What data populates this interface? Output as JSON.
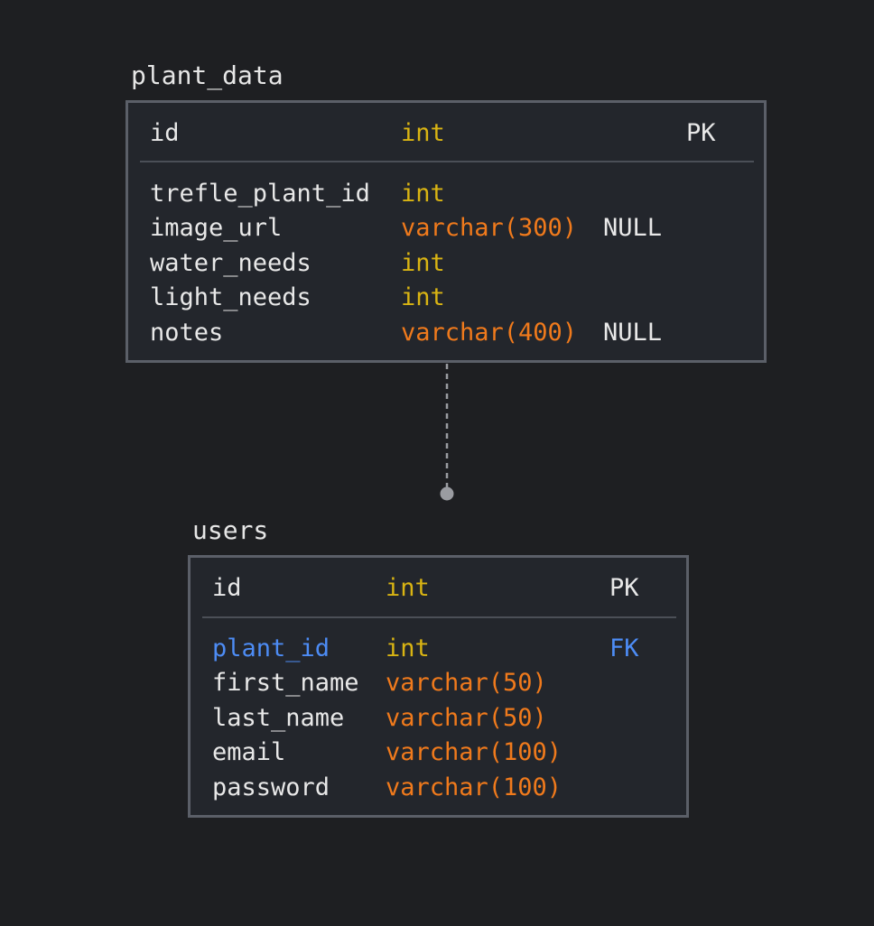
{
  "tables": {
    "plant_data": {
      "name": "plant_data",
      "pk_row": {
        "name": "id",
        "type": "int",
        "key": "PK"
      },
      "rows": [
        {
          "name": "trefle_plant_id",
          "type": "int",
          "nullable": ""
        },
        {
          "name": "image_url",
          "type": "varchar(300)",
          "nullable": "NULL"
        },
        {
          "name": "water_needs",
          "type": "int",
          "nullable": ""
        },
        {
          "name": "light_needs",
          "type": "int",
          "nullable": ""
        },
        {
          "name": "notes",
          "type": "varchar(400)",
          "nullable": "NULL"
        }
      ]
    },
    "users": {
      "name": "users",
      "pk_row": {
        "name": "id",
        "type": "int",
        "key": "PK"
      },
      "rows": [
        {
          "name": "plant_id",
          "type": "int",
          "key": "FK"
        },
        {
          "name": "first_name",
          "type": "varchar(50)",
          "key": ""
        },
        {
          "name": "last_name",
          "type": "varchar(50)",
          "key": ""
        },
        {
          "name": "email",
          "type": "varchar(100)",
          "key": ""
        },
        {
          "name": "password",
          "type": "varchar(100)",
          "key": ""
        }
      ]
    }
  },
  "colors": {
    "background": "#1e1f22",
    "table_fill": "#23262c",
    "table_border": "#5b5f68",
    "name_text": "#e8e8e8",
    "int_type": "#d9b413",
    "varchar_type": "#f07a1c",
    "foreign_key": "#4d8cf5",
    "connector": "#9a9ca1"
  }
}
